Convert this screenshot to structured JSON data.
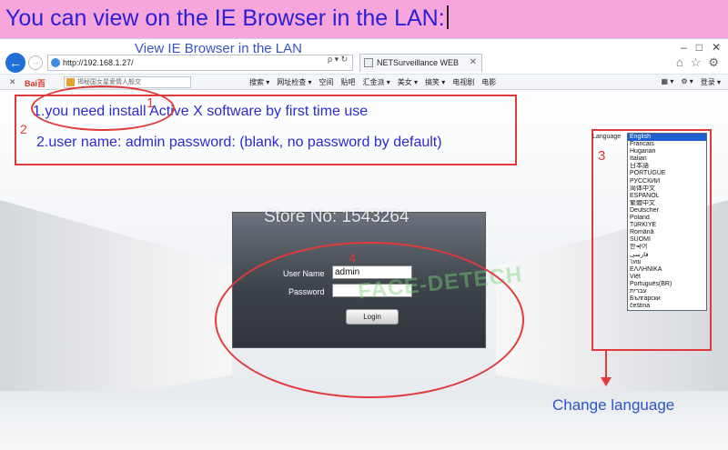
{
  "banner": {
    "text": "You can view on the IE Browser in the LAN:"
  },
  "window": {
    "caption_overlay": "View IE Browser in the LAN",
    "controls": [
      "–",
      "□",
      "✕"
    ]
  },
  "address_bar": {
    "url": "http://192.168.1.27/",
    "tools": "ρ ▾ ↻"
  },
  "tab": {
    "title": "NETSurveillance WEB",
    "close": "✕"
  },
  "toolbar": {
    "logo": "Bai百",
    "search_placeholder": "揭秘国女星爱情人般交",
    "items": [
      "搜索 ▾",
      "网址检查 ▾",
      "空间",
      "贴吧",
      "汇金派 ▾",
      "美女 ▾",
      "搞笑 ▾",
      "电视剧",
      "电影"
    ],
    "right_items": [
      "▦ ▾",
      "⚙ ▾",
      "登录 ▾"
    ]
  },
  "instructions": {
    "line1": "1.you need install Active X software by first time use",
    "line2": "2.user name: admin  password:  (blank, no password by default)"
  },
  "login": {
    "username_label": "User Name",
    "username_value": "admin",
    "password_label": "Password",
    "login_button": "Login"
  },
  "watermarks": {
    "store": "Store No: 1543264",
    "brand": "FACE-DETECH"
  },
  "language": {
    "label": "Language",
    "selected": "English",
    "options": [
      "English",
      "Francais",
      "Hugarian",
      "Italian",
      "日本語",
      "PORTUGUÊ",
      "РУССКИЙ",
      "简体中文",
      "ESPAÑOL",
      "繁體中文",
      "Deutscher",
      "Poland",
      "TüRKİYE",
      "Română",
      "SUOMI",
      "한국어",
      "فارسی",
      "ไทย",
      "ΕΛΛΗΝΙΚΑ",
      "Việt",
      "Português(BR)",
      "עברית",
      "Български",
      "čeština"
    ]
  },
  "annotations": {
    "n1": "1",
    "n2": "2",
    "n3": "3",
    "n4": "4",
    "change_language": "Change language"
  },
  "colors": {
    "banner_bg": "#f7a6dc",
    "banner_text": "#2a1fd6",
    "annotation_red": "#e03a3a",
    "instruction_blue": "#2b2bd0",
    "selected_lang_bg": "#1f5fd0"
  }
}
